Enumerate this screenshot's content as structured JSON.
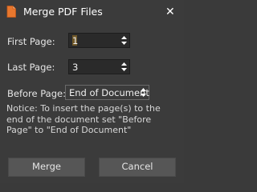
{
  "window": {
    "title": "Merge PDF Files",
    "close_glyph": "✕"
  },
  "fields": {
    "first_page": {
      "label": "First Page:",
      "value": "1"
    },
    "last_page": {
      "label": "Last Page:",
      "value": "3"
    },
    "before_page": {
      "label": "Before Page:",
      "value": "End of Document"
    }
  },
  "notice": "Notice: To insert the page(s) to the end of the document set \"Before Page\" to \"End of Document\"",
  "buttons": {
    "merge": "Merge",
    "cancel": "Cancel"
  },
  "colors": {
    "background": "#3b3b3b",
    "icon_accent": "#e8772e"
  }
}
